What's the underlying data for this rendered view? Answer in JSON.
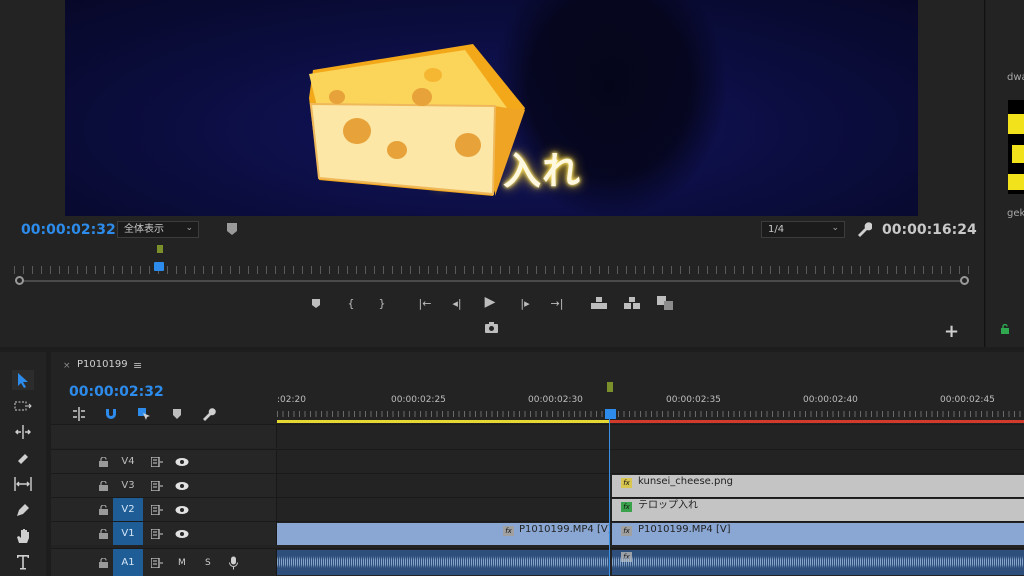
{
  "program_monitor": {
    "caption": "ップ入れ",
    "timecode_current": "00:00:02:32",
    "timecode_duration": "00:00:16:24",
    "fit_dropdown": "全体表示",
    "resolution_dropdown": "1/4"
  },
  "project_panel": {
    "item1_name": "dwa",
    "item2_name": "gek"
  },
  "timeline": {
    "sequence_name": "P1010199",
    "timecode": "00:00:02:32",
    "ruler_labels": [
      ":02:20",
      "00:00:02:25",
      "00:00:02:30",
      "00:00:02:35",
      "00:00:02:40",
      "00:00:02:45"
    ],
    "tracks": {
      "v4": "V4",
      "v3": "V3",
      "v2": "V2",
      "v1": "V1",
      "a1": "A1",
      "a1_mute": "M",
      "a1_solo": "S"
    },
    "clips": {
      "v3_clip": "kunsei_cheese.png",
      "v2_clip": "テロップ入れ",
      "v1_clip_a": "P1010199.MP4 [V]",
      "v1_clip_b": "P1010199.MP4 [V]"
    },
    "colors": {
      "accent": "#2d8ceb",
      "work_area": "#e6d833",
      "render_bar": "#d13b2c",
      "video_clip": "#8aa7d4",
      "graphic_clip": "#c4c4c4",
      "audio_clip": "#2e4f7c"
    }
  }
}
